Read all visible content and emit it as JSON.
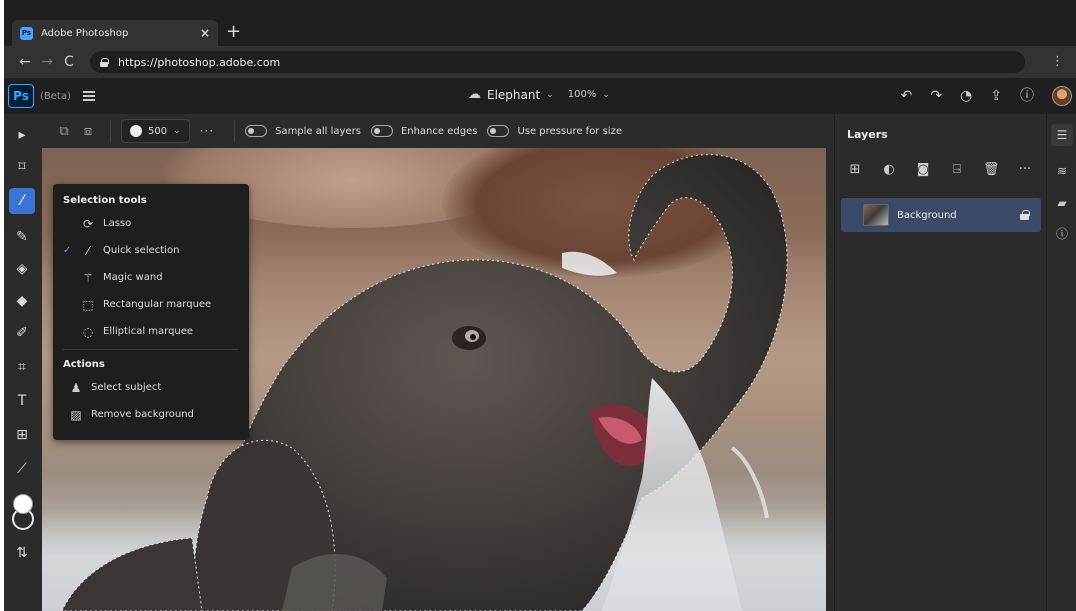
{
  "browser": {
    "tab_title": "Adobe Photoshop",
    "tab_favicon": "Ps",
    "tab_close": "×",
    "new_tab": "+",
    "url": "https://photoshop.adobe.com",
    "back_icon": "←",
    "forward_icon": "→",
    "reload_icon": "C",
    "menu_icon": "⋮"
  },
  "appbar": {
    "logo": "Ps",
    "beta": "(Beta)",
    "doc_name": "Elephant",
    "doc_chevron": "⌄",
    "zoom": "100%",
    "zoom_chevron": "⌄",
    "icons": [
      "undo-icon",
      "redo-icon",
      "comment-icon",
      "share-icon",
      "help-icon",
      "avatar"
    ]
  },
  "options_bar": {
    "brush_size": "500",
    "brush_chevron": "⌄",
    "more": "···",
    "toggles": [
      {
        "label": "Sample all layers",
        "on": false
      },
      {
        "label": "Enhance edges",
        "on": false
      },
      {
        "label": "Use pressure for size",
        "on": false
      }
    ]
  },
  "flyout": {
    "selection_heading": "Selection tools",
    "selection_items": [
      {
        "label": "Lasso",
        "icon": "lasso-icon",
        "checked": false
      },
      {
        "label": "Quick selection",
        "icon": "quick-selection-icon",
        "checked": true
      },
      {
        "label": "Magic wand",
        "icon": "magic-wand-icon",
        "checked": false
      },
      {
        "label": "Rectangular marquee",
        "icon": "rectangular-marquee-icon",
        "checked": false
      },
      {
        "label": "Elliptical marquee",
        "icon": "elliptical-marquee-icon",
        "checked": false
      }
    ],
    "actions_heading": "Actions",
    "action_items": [
      {
        "label": "Select subject",
        "icon": "select-subject-icon"
      },
      {
        "label": "Remove background",
        "icon": "remove-background-icon"
      }
    ]
  },
  "layers": {
    "title": "Layers",
    "actions": [
      "add-layer-icon",
      "adjustment-icon",
      "mask-icon",
      "import-icon",
      "delete-icon",
      "more-icon"
    ],
    "items": [
      {
        "name": "Background",
        "locked": true,
        "selected": true
      }
    ]
  },
  "colors": {
    "accent": "#3c74d6",
    "selection_row": "#3b4a66",
    "foreground_color": "#ffffff"
  }
}
